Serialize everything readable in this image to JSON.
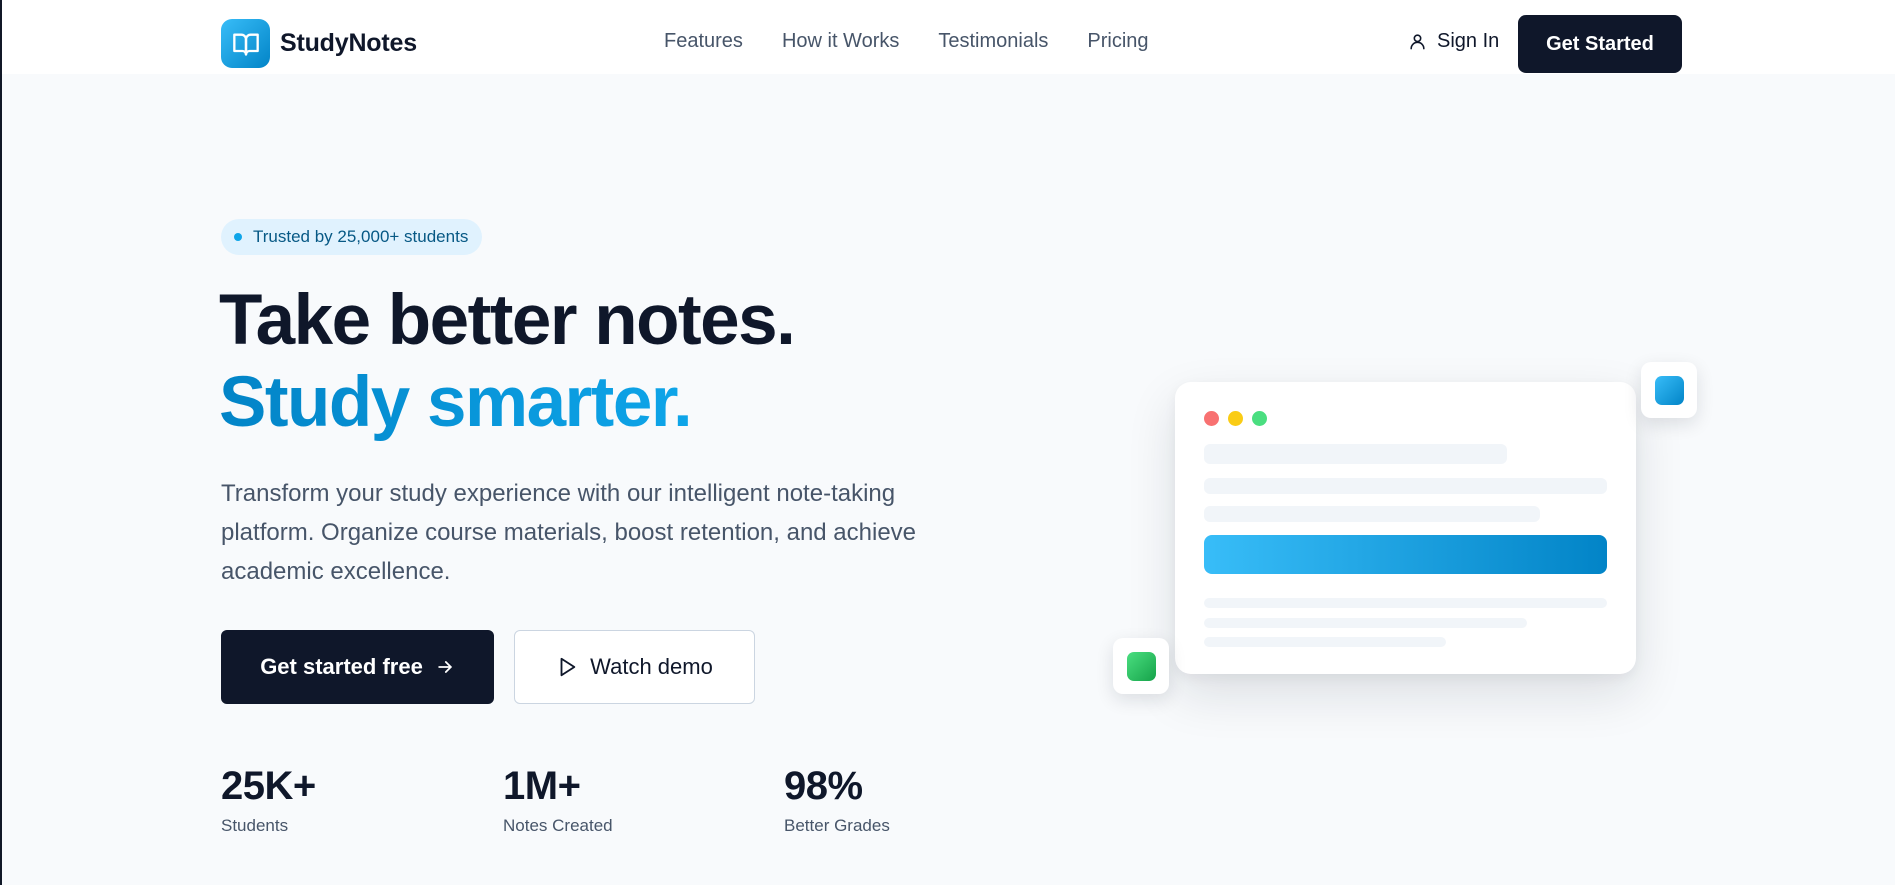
{
  "brand": {
    "name": "StudyNotes",
    "logo_icon": "book-open-icon",
    "accent": "#0ea5e9"
  },
  "nav": {
    "links": [
      {
        "label": "Features"
      },
      {
        "label": "How it Works"
      },
      {
        "label": "Testimonials"
      },
      {
        "label": "Pricing"
      }
    ],
    "sign_in_label": "Sign In",
    "sign_in_icon": "user-icon",
    "cta_label": "Get Started"
  },
  "hero": {
    "badge_text": "Trusted by 25,000+ students",
    "title_line1": "Take better notes.",
    "title_line2": "Study smarter.",
    "description": "Transform your study experience with our intelligent note-taking platform. Organize course materials, boost retention, and achieve academic excellence.",
    "primary_button_label": "Get started free",
    "primary_button_icon": "arrow-right-icon",
    "secondary_button_label": "Watch demo",
    "secondary_button_icon": "play-icon"
  },
  "stats": [
    {
      "value": "25K+",
      "label": "Students"
    },
    {
      "value": "1M+",
      "label": "Notes Created"
    },
    {
      "value": "98%",
      "label": "Better Grades"
    }
  ],
  "mockup": {
    "window_dot_colors": [
      "#f87171",
      "#facc15",
      "#4ade80"
    ],
    "accent_bar_colors": [
      "#38bdf8",
      "#0284c7"
    ],
    "float_tile_colors": [
      "#0ea5e9",
      "#22c55e"
    ]
  },
  "colors": {
    "dark": "#0f172a",
    "page_background": "#f8fafc",
    "text_muted": "#475569"
  }
}
